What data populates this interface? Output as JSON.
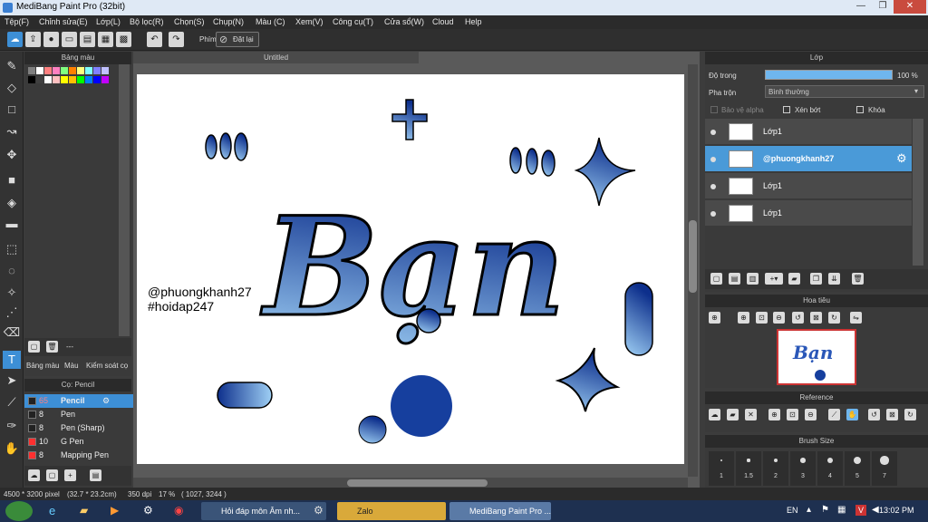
{
  "window": {
    "title": "MediBang Paint Pro (32bit)"
  },
  "menu": [
    "Tệp(F)",
    "Chỉnh sửa(E)",
    "Lớp(L)",
    "Bộ lọc(R)",
    "Chọn(S)",
    "Chụp(N)",
    "Màu (C)",
    "Xem(V)",
    "Công cụ(T)",
    "Cửa sổ(W)",
    "Cloud",
    "Help"
  ],
  "toolbar": {
    "shortcut_label": "Phím",
    "reset_label": "Đặt lại"
  },
  "palette": {
    "title": "Bảng màu",
    "colors_row1": [
      "#7f7f7f",
      "#ffffff",
      "#ff8080",
      "#ff80c0",
      "#80ff80",
      "#ff8000",
      "#ffff80",
      "#80ffff",
      "#8080ff",
      "#c0c0ff"
    ],
    "colors_row2": [
      "#000000",
      "#404040",
      "#ffffff",
      "#ffc0c0",
      "#ffff00",
      "#ffc000",
      "#00ff00",
      "#0080ff",
      "#0000ff",
      "#c000ff"
    ],
    "footer_text": "---",
    "tabs": [
      "Bảng màu",
      "Màu",
      "Kiểm soát cọ"
    ]
  },
  "brush": {
    "title": "Cọ: Pencil",
    "items": [
      {
        "size": "65",
        "name": "Pencil",
        "color": "#222222"
      },
      {
        "size": "8",
        "name": "Pen",
        "color": "#222222"
      },
      {
        "size": "8",
        "name": "Pen (Sharp)",
        "color": "#222222"
      },
      {
        "size": "10",
        "name": "G Pen",
        "color": "#ff3030"
      },
      {
        "size": "8",
        "name": "Mapping Pen",
        "color": "#ff3030"
      }
    ]
  },
  "canvas": {
    "tab": "Untitled",
    "credit_line1": "@phuongkhanh27",
    "credit_line2": "#hoidap247",
    "art_text": "Bạn",
    "art_colors": {
      "dark": "#0d2f8c",
      "light": "#9fd0f5"
    }
  },
  "layers": {
    "title": "Lớp",
    "opacity_label": "Độ trong",
    "opacity_value": "100 %",
    "blend_label": "Pha trộn",
    "blend_value": "Bình thường",
    "protect_alpha": "Bảo vệ alpha",
    "clipping": "Xén bớt",
    "lock": "Khóa",
    "items": [
      "Lớp1",
      "@phuongkhanh27",
      "Lớp1",
      "Lớp1"
    ]
  },
  "navigator": {
    "title": "Hoa tiêu",
    "thumb_text": "Bạn"
  },
  "reference": {
    "title": "Reference"
  },
  "brush_size": {
    "title": "Brush Size",
    "sizes": [
      "1",
      "1.5",
      "2",
      "3",
      "4",
      "5",
      "7"
    ]
  },
  "status": {
    "dimensions": "4500 * 3200 pixel",
    "physical": "(32.7 * 23.2cm)",
    "dpi": "350 dpi",
    "zoom": "17 %",
    "cursor": "( 1027, 3244 )"
  },
  "taskbar": {
    "tasks": [
      "Hỏi đáp môn Âm nh...",
      "Zalo",
      "MediBang Paint Pro ..."
    ],
    "lang": "EN",
    "time": "13:02 PM"
  }
}
